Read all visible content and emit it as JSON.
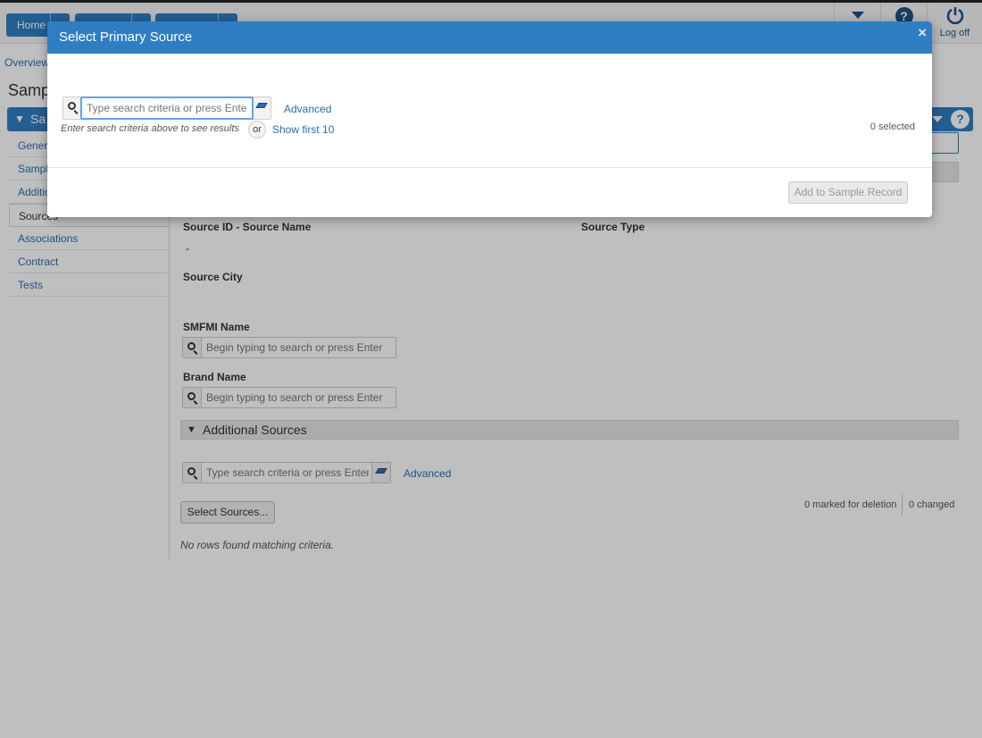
{
  "topnav": {
    "home_label": "Home",
    "logoff_label": "Log off"
  },
  "breadcrumb": "Overview",
  "page_title": "Samp",
  "section_bar_label": "Sa",
  "sidenav": {
    "items": [
      "Genera",
      "Sample",
      "Additio",
      "Sources",
      "Associations",
      "Contract",
      "Tests"
    ]
  },
  "sources_section": {
    "source_id_label": "Source ID - Source Name",
    "source_id_value": "-",
    "source_type_label": "Source Type",
    "source_city_label": "Source City",
    "smfmi_label": "SMFMI Name",
    "smfmi_placeholder": "Begin typing to search or press Enter",
    "brand_label": "Brand Name",
    "brand_placeholder": "Begin typing to search or press Enter"
  },
  "additional_sources": {
    "header": "Additional Sources",
    "search_placeholder": "Type search criteria or press Enter",
    "advanced_label": "Advanced",
    "select_button": "Select Sources...",
    "marked_for_deletion": "0 marked for deletion",
    "changed": "0 changed",
    "no_rows": "No rows found matching criteria."
  },
  "modal": {
    "title": "Select Primary Source",
    "close_glyph": "×",
    "search_placeholder": "Type search criteria or press Enter",
    "advanced_label": "Advanced",
    "hint": "Enter search criteria above to see results",
    "or_label": "or",
    "show_first": "Show first 10",
    "selected_count": "0 selected",
    "add_button": "Add to Sample Record"
  },
  "colors": {
    "primary": "#2f7ec4",
    "link": "#2a6db0",
    "focus": "#66a3e0"
  }
}
